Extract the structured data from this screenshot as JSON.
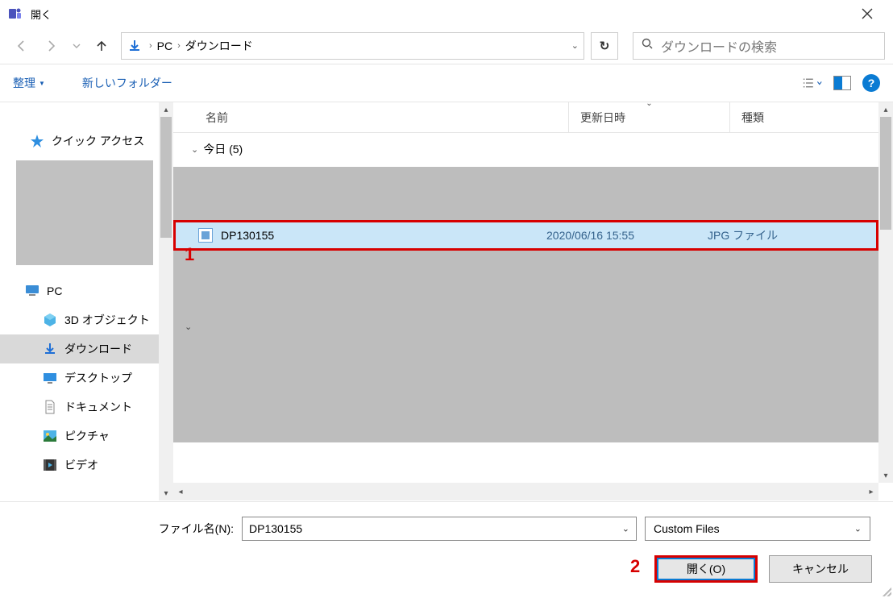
{
  "title_bar": {
    "title": "開く"
  },
  "nav": {
    "breadcrumb": {
      "pc": "PC",
      "downloads": "ダウンロード"
    },
    "search_placeholder": "ダウンロードの検索"
  },
  "toolbar": {
    "organize": "整理",
    "new_folder": "新しいフォルダー"
  },
  "columns": {
    "name": "名前",
    "date": "更新日時",
    "type": "種類"
  },
  "group": {
    "today_label": "今日 (5)"
  },
  "files": [
    {
      "name": "DP130155",
      "date": "2020/06/16 15:55",
      "type": "JPG ファイル"
    }
  ],
  "sidebar": {
    "quick_access": "クイック アクセス",
    "pc": "PC",
    "items": [
      {
        "label": "3D オブジェクト"
      },
      {
        "label": "ダウンロード"
      },
      {
        "label": "デスクトップ"
      },
      {
        "label": "ドキュメント"
      },
      {
        "label": "ピクチャ"
      },
      {
        "label": "ビデオ"
      }
    ]
  },
  "footer": {
    "filename_label": "ファイル名(N):",
    "filename_value": "DP130155",
    "filetype": "Custom Files",
    "open": "開く(O)",
    "cancel": "キャンセル"
  },
  "annotations": {
    "one": "1",
    "two": "2"
  }
}
